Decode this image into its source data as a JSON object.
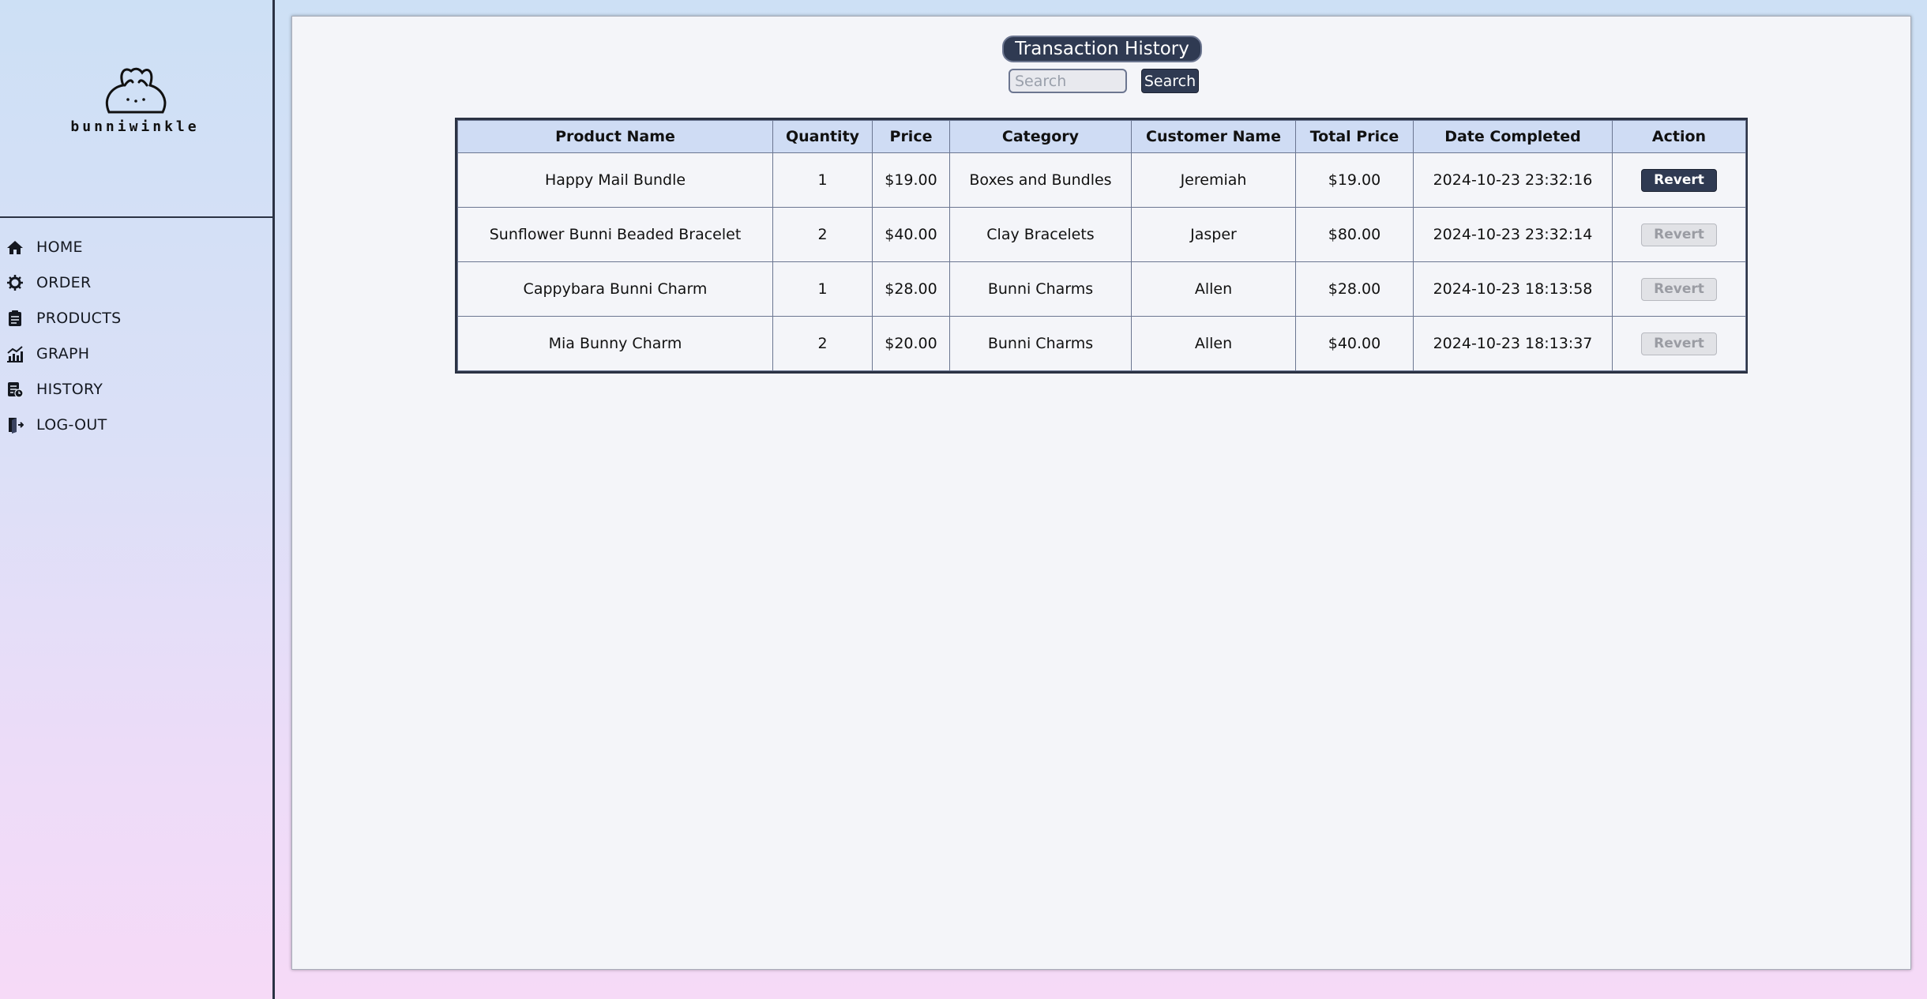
{
  "sidebar": {
    "logo_text": "bunniwinkle",
    "items": [
      {
        "label": "HOME",
        "icon": "home-icon"
      },
      {
        "label": "ORDER",
        "icon": "order-icon"
      },
      {
        "label": "PRODUCTS",
        "icon": "products-icon"
      },
      {
        "label": "GRAPH",
        "icon": "graph-icon"
      },
      {
        "label": "HISTORY",
        "icon": "history-icon"
      },
      {
        "label": "LOG-OUT",
        "icon": "logout-icon"
      }
    ]
  },
  "main": {
    "title": "Transaction History",
    "search": {
      "placeholder": "Search",
      "value": "",
      "button_label": "Search"
    },
    "table": {
      "headers": [
        "Product Name",
        "Quantity",
        "Price",
        "Category",
        "Customer Name",
        "Total Price",
        "Date Completed",
        "Action"
      ],
      "rows": [
        {
          "product": "Happy Mail Bundle",
          "quantity": "1",
          "price": "$19.00",
          "category": "Boxes and Bundles",
          "customer": "Jeremiah",
          "total": "$19.00",
          "date": "2024-10-23 23:32:16",
          "action": "Revert",
          "enabled": true
        },
        {
          "product": "Sunflower Bunni Beaded Bracelet",
          "quantity": "2",
          "price": "$40.00",
          "category": "Clay Bracelets",
          "customer": "Jasper",
          "total": "$80.00",
          "date": "2024-10-23 23:32:14",
          "action": "Revert",
          "enabled": false
        },
        {
          "product": "Cappybara Bunni Charm",
          "quantity": "1",
          "price": "$28.00",
          "category": "Bunni Charms",
          "customer": "Allen",
          "total": "$28.00",
          "date": "2024-10-23 18:13:58",
          "action": "Revert",
          "enabled": false
        },
        {
          "product": "Mia Bunny Charm",
          "quantity": "2",
          "price": "$20.00",
          "category": "Bunni Charms",
          "customer": "Allen",
          "total": "$40.00",
          "date": "2024-10-23 18:13:37",
          "action": "Revert",
          "enabled": false
        }
      ]
    }
  },
  "colors": {
    "accent": "#2f3a52",
    "header_bg": "#cfdcf4",
    "content_bg": "#f4f5f9"
  }
}
